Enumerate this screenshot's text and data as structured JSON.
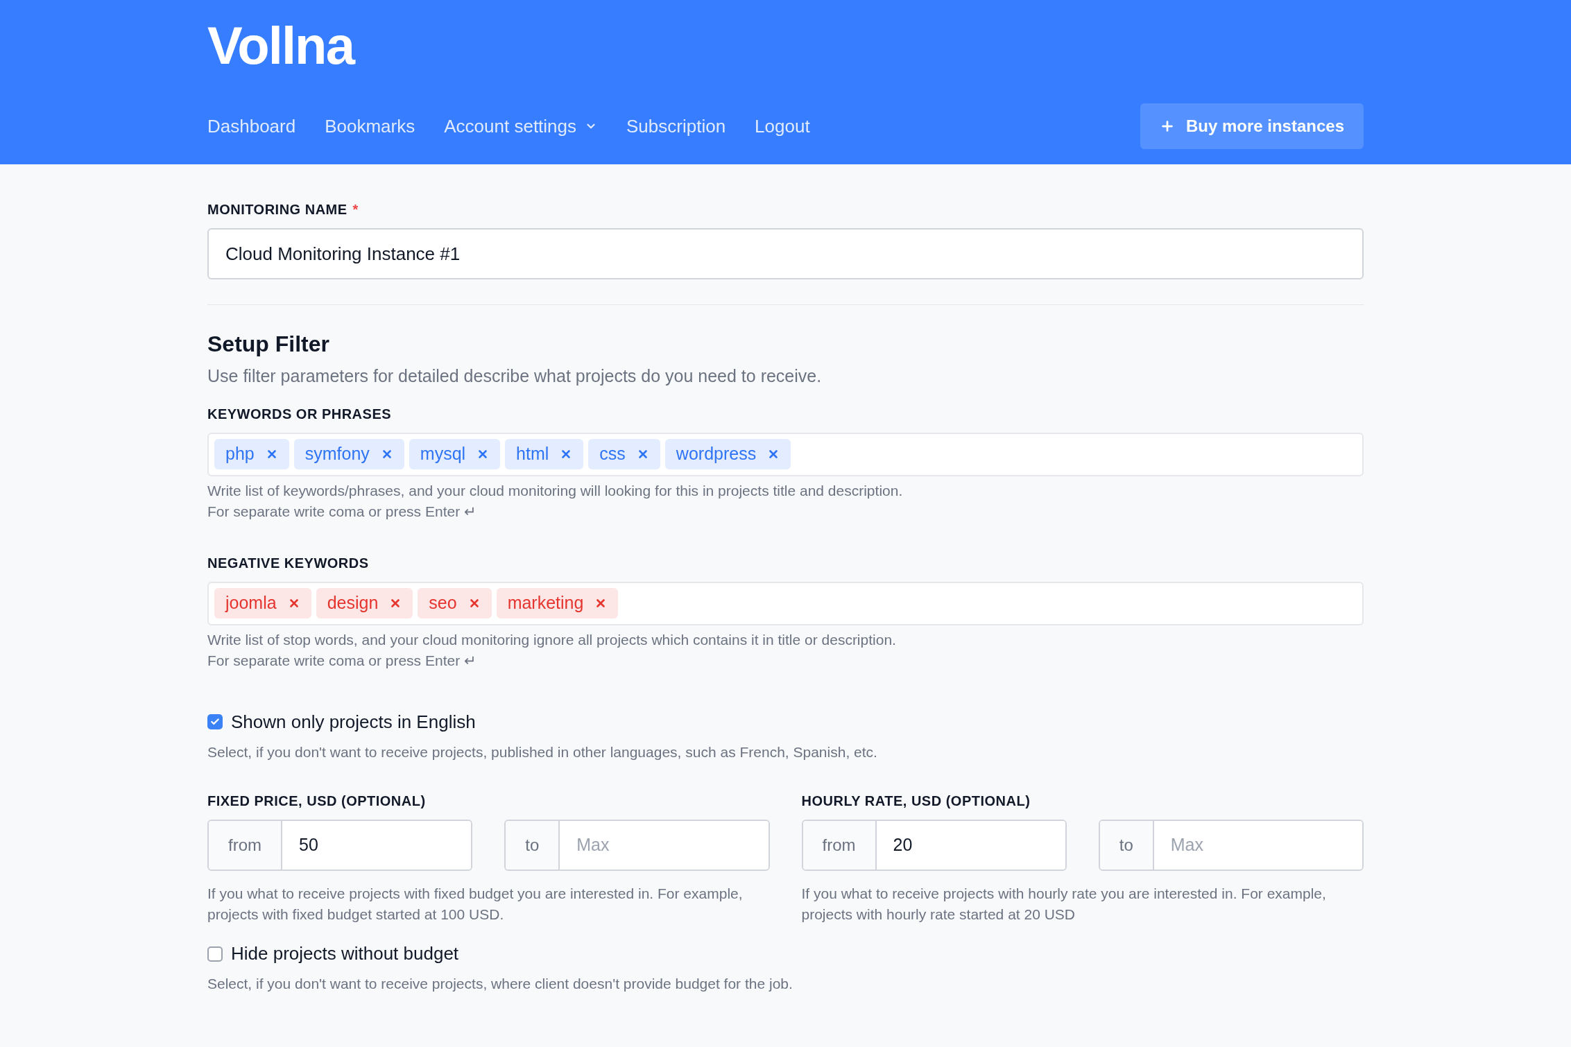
{
  "header": {
    "logo": "Vollna",
    "nav": [
      {
        "label": "Dashboard",
        "dropdown": false
      },
      {
        "label": "Bookmarks",
        "dropdown": false
      },
      {
        "label": "Account settings",
        "dropdown": true
      },
      {
        "label": "Subscription",
        "dropdown": false
      },
      {
        "label": "Logout",
        "dropdown": false
      }
    ],
    "action_button": "Buy more instances"
  },
  "monitoring_name": {
    "label": "MONITORING NAME",
    "required_mark": "*",
    "value": "Cloud Monitoring Instance #1"
  },
  "setup_filter": {
    "title": "Setup Filter",
    "subtitle": "Use filter parameters for detailed describe what projects do you need to receive."
  },
  "tag_fields": [
    {
      "kind": "positive",
      "label": "KEYWORDS OR PHRASES",
      "tags": [
        "php",
        "symfony",
        "mysql",
        "html",
        "css",
        "wordpress"
      ],
      "help": [
        "Write list of keywords/phrases, and your cloud monitoring will looking for this in projects title and description.",
        "For separate write coma or press Enter ↵"
      ]
    },
    {
      "kind": "negative",
      "label": "NEGATIVE KEYWORDS",
      "tags": [
        "joomla",
        "design",
        "seo",
        "marketing"
      ],
      "help": [
        "Write list of stop words, and your cloud monitoring ignore all projects which contains it in title or description.",
        "For separate write coma or press Enter ↵"
      ]
    }
  ],
  "english_only": {
    "label": "Shown only projects in English",
    "checked": true,
    "help": "Select, if you don't want to receive projects, published in other languages, such as French, Spanish, etc."
  },
  "price_groups": [
    {
      "label": "FIXED PRICE, USD (OPTIONAL)",
      "from": {
        "prefix": "from",
        "value": "50"
      },
      "to": {
        "prefix": "to",
        "placeholder": "Max"
      },
      "help": "If you what to receive projects with fixed budget you are interested in. For example, projects with fixed budget started at 100 USD."
    },
    {
      "label": "HOURLY RATE, USD (OPTIONAL)",
      "from": {
        "prefix": "from",
        "value": "20"
      },
      "to": {
        "prefix": "to",
        "placeholder": "Max"
      },
      "help": "If you what to receive projects with hourly rate you are interested in. For example, projects with hourly rate started at 20 USD"
    }
  ],
  "hide_no_budget": {
    "label": "Hide projects without budget",
    "checked": false,
    "help": "Select, if you don't want to receive projects, where client doesn't provide budget for the job."
  }
}
